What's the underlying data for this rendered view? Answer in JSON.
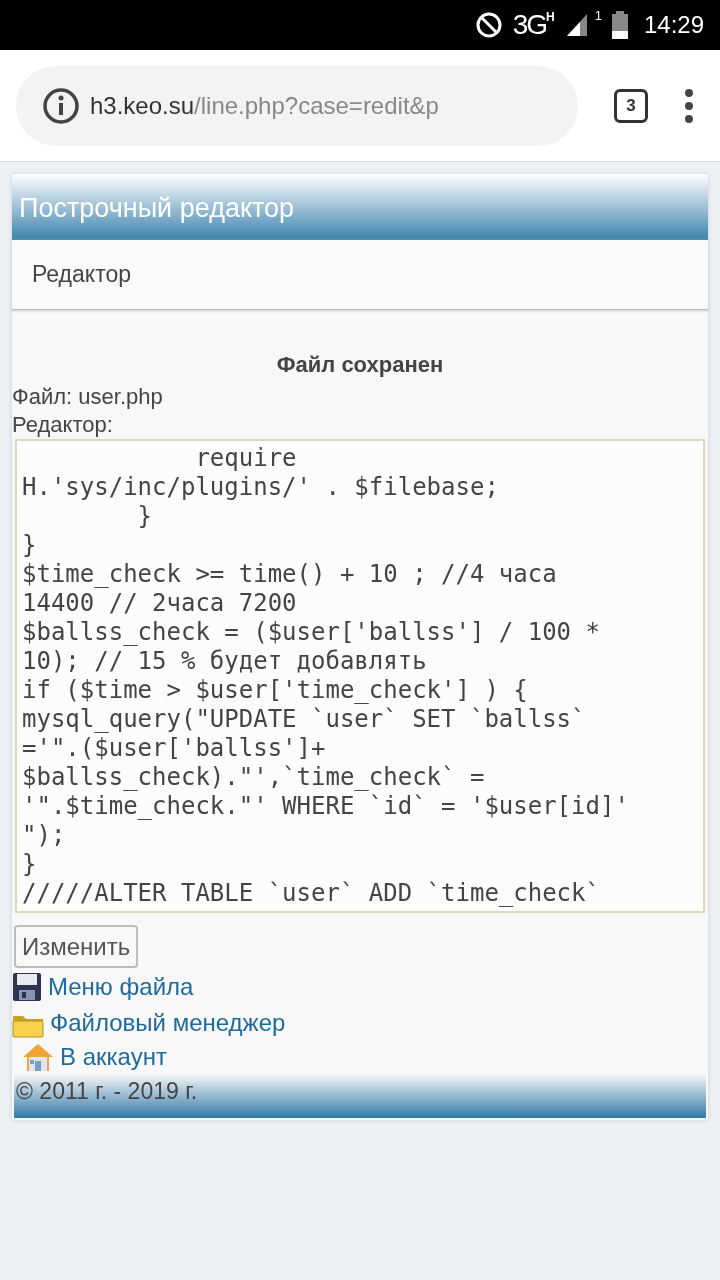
{
  "status_bar": {
    "network": "3G",
    "network_sub": "H",
    "sim": "1",
    "time": "14:29"
  },
  "browser": {
    "url_host": "h3.keo.su",
    "url_path": "/line.php?case=redit&p",
    "tab_count": "3"
  },
  "page": {
    "title": "Построчный редактор",
    "section": "Редактор",
    "message": "Файл сохранен",
    "file_label": "Файл: user.php",
    "editor_label": "Редактор:",
    "code_lines": [
      "            require",
      "H.'sys/inc/plugins/' . $filebase;",
      "        }",
      "}",
      "$time_check >= time() + 10 ; //4 часа",
      "14400 // 2часа 7200",
      "$ballss_check = ($user['ballss'] / 100 *",
      "10); // 15 % будет добавлять",
      "if ($time > $user['time_check'] ) {",
      "mysql_query(\"UPDATE `user` SET `ballss`",
      "='\".($user['ballss']+",
      "$ballss_check).\"',`time_check` =",
      "'\".$time_check.\"' WHERE `id` = '$user[id]'",
      "\");",
      "}",
      "/////ALTER TABLE `user` ADD `time_check`"
    ],
    "submit": "Изменить",
    "links": [
      {
        "kind": "floppy",
        "label": "Меню файла"
      },
      {
        "kind": "folder",
        "label": "Файловый менеджер"
      },
      {
        "kind": "house",
        "label": "В аккаунт"
      }
    ],
    "footer": "© 2011 г. - 2019 г."
  }
}
